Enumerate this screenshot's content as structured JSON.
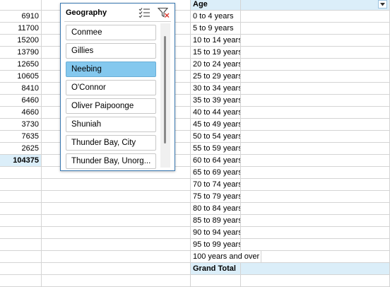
{
  "colors": {
    "header_fill": "#dbeef9",
    "selected_item": "#84c8ee",
    "slicer_border": "#3a78b0"
  },
  "left_values": [
    "6910",
    "11700",
    "15200",
    "13790",
    "12650",
    "10605",
    "8410",
    "6460",
    "4660",
    "3730",
    "7635",
    "2625",
    "104375"
  ],
  "pivot": {
    "header": "Age",
    "header_dropdown_icon": "dropdown-arrow-icon",
    "rows": [
      "0 to 4 years",
      "5 to 9 years",
      "10 to 14 years",
      "15 to 19 years",
      "20 to 24 years",
      "25 to 29 years",
      "30 to 34 years",
      "35 to 39 years",
      "40 to 44 years",
      "45 to 49 years",
      "50 to 54 years",
      "55 to 59 years",
      "60 to 64 years",
      "65 to 69 years",
      "70 to 74 years",
      "75 to 79 years",
      "80 to 84 years",
      "85 to 89 years",
      "90 to 94 years",
      "95 to 99 years",
      "100 years and over"
    ],
    "total_label": "Grand Total"
  },
  "slicer": {
    "title": "Geography",
    "icons": [
      "multi-select-icon",
      "clear-filter-icon"
    ],
    "items": [
      {
        "label": "Conmee",
        "selected": false
      },
      {
        "label": "Gillies",
        "selected": false
      },
      {
        "label": "Neebing",
        "selected": true
      },
      {
        "label": "O'Connor",
        "selected": false
      },
      {
        "label": "Oliver Paipoonge",
        "selected": false
      },
      {
        "label": "Shuniah",
        "selected": false
      },
      {
        "label": "Thunder Bay, City",
        "selected": false
      },
      {
        "label": "Thunder Bay, Unorg..."
      }
    ]
  }
}
